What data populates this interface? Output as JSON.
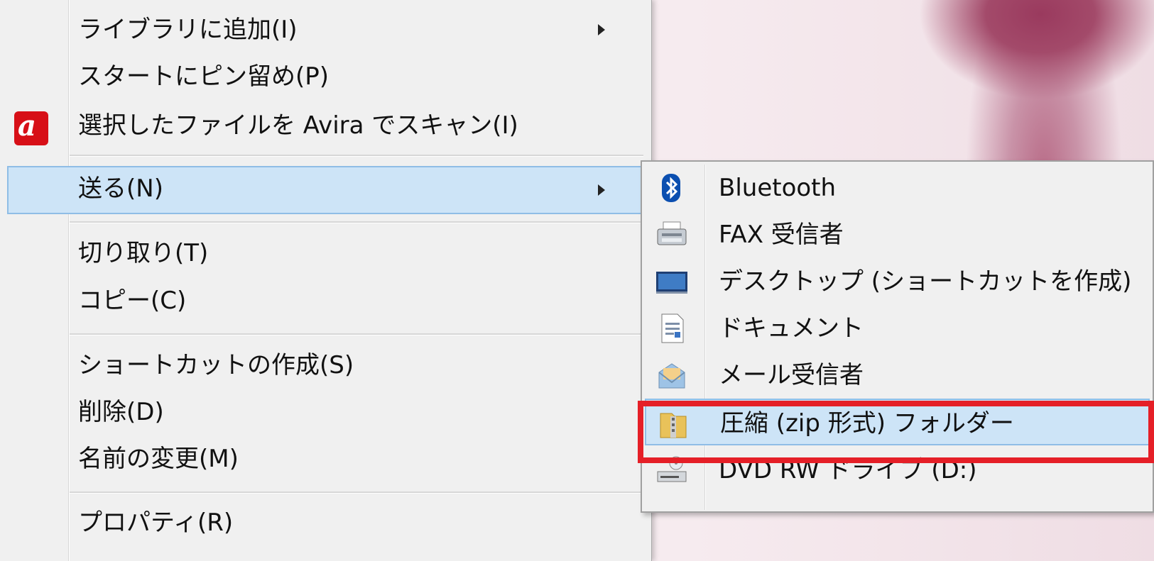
{
  "context_menu": {
    "items": [
      {
        "label": "ライブラリに追加(I)",
        "submenu": true
      },
      {
        "label": "スタートにピン留め(P)"
      },
      {
        "label": "選択したファイルを Avira でスキャン(I)",
        "icon": "avira-icon"
      },
      {
        "label": "送る(N)",
        "submenu": true,
        "selected": true
      },
      {
        "label": "切り取り(T)"
      },
      {
        "label": "コピー(C)"
      },
      {
        "label": "ショートカットの作成(S)"
      },
      {
        "label": "削除(D)"
      },
      {
        "label": "名前の変更(M)"
      },
      {
        "label": "プロパティ(R)"
      }
    ]
  },
  "send_to_menu": {
    "items": [
      {
        "label": "Bluetooth",
        "icon": "bluetooth-icon"
      },
      {
        "label": "FAX 受信者",
        "icon": "fax-icon"
      },
      {
        "label": "デスクトップ (ショートカットを作成)",
        "icon": "desktop-icon"
      },
      {
        "label": "ドキュメント",
        "icon": "document-icon"
      },
      {
        "label": "メール受信者",
        "icon": "mail-icon"
      },
      {
        "label": "圧縮 (zip 形式) フォルダー",
        "icon": "zip-folder-icon",
        "selected": true
      },
      {
        "label": "DVD RW ドライブ (D:)",
        "icon": "dvd-drive-icon"
      }
    ]
  },
  "colors": {
    "menu_bg": "#f0f0f0",
    "selection_bg": "#cde4f7",
    "selection_border": "#8fbde6",
    "highlight_frame": "#e51f27",
    "avira_red": "#d70f17"
  }
}
